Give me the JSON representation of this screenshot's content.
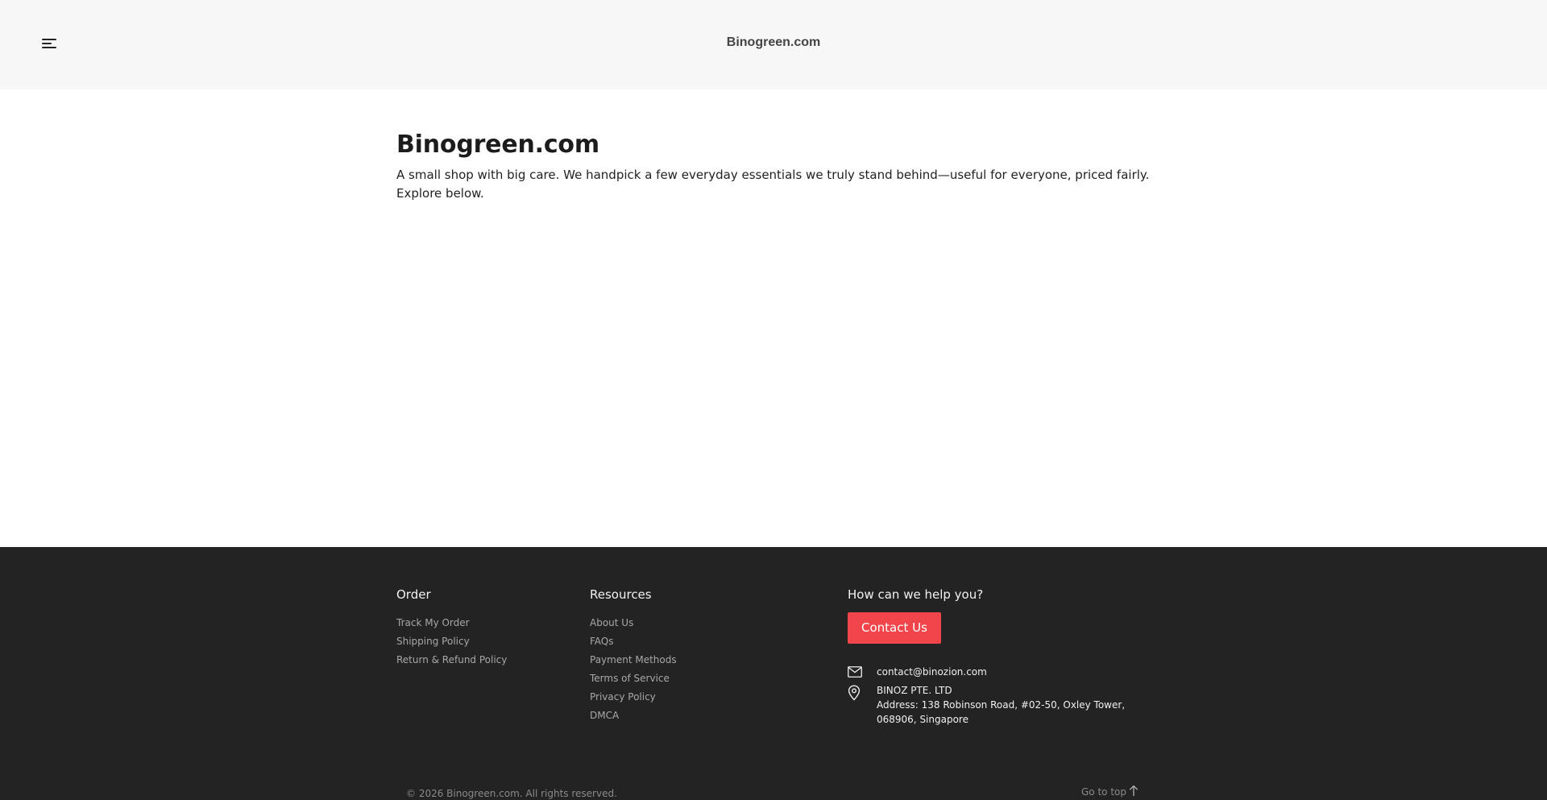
{
  "header": {
    "site_title": "Binogreen.com",
    "menu_icon": "hamburger-menu-icon"
  },
  "main": {
    "title": "Binogreen.com",
    "intro": "A small shop with big care. We handpick a few everyday essentials we truly stand behind—useful for everyone, priced fairly. Explore below."
  },
  "footer": {
    "order": {
      "title": "Order",
      "links": [
        "Track My Order",
        "Shipping Policy",
        "Return & Refund Policy"
      ]
    },
    "resources": {
      "title": "Resources",
      "links": [
        "About Us",
        "FAQs",
        "Payment Methods",
        "Terms of Service",
        "Privacy Policy",
        "DMCA"
      ]
    },
    "help": {
      "title": "How can we help you?",
      "contact_label": "Contact Us",
      "email": "contact@binozion.com",
      "company": "BINOZ PTE. LTD",
      "address": "Address: 138 Robinson Road, #02-50, Oxley Tower, 068906, Singapore"
    },
    "copyright": "© 2026 Binogreen.com. All rights reserved.",
    "go_to_top": "Go to top"
  },
  "colors": {
    "header_bg": "#f7f7f7",
    "footer_bg": "#232323",
    "accent": "#f0454b"
  }
}
